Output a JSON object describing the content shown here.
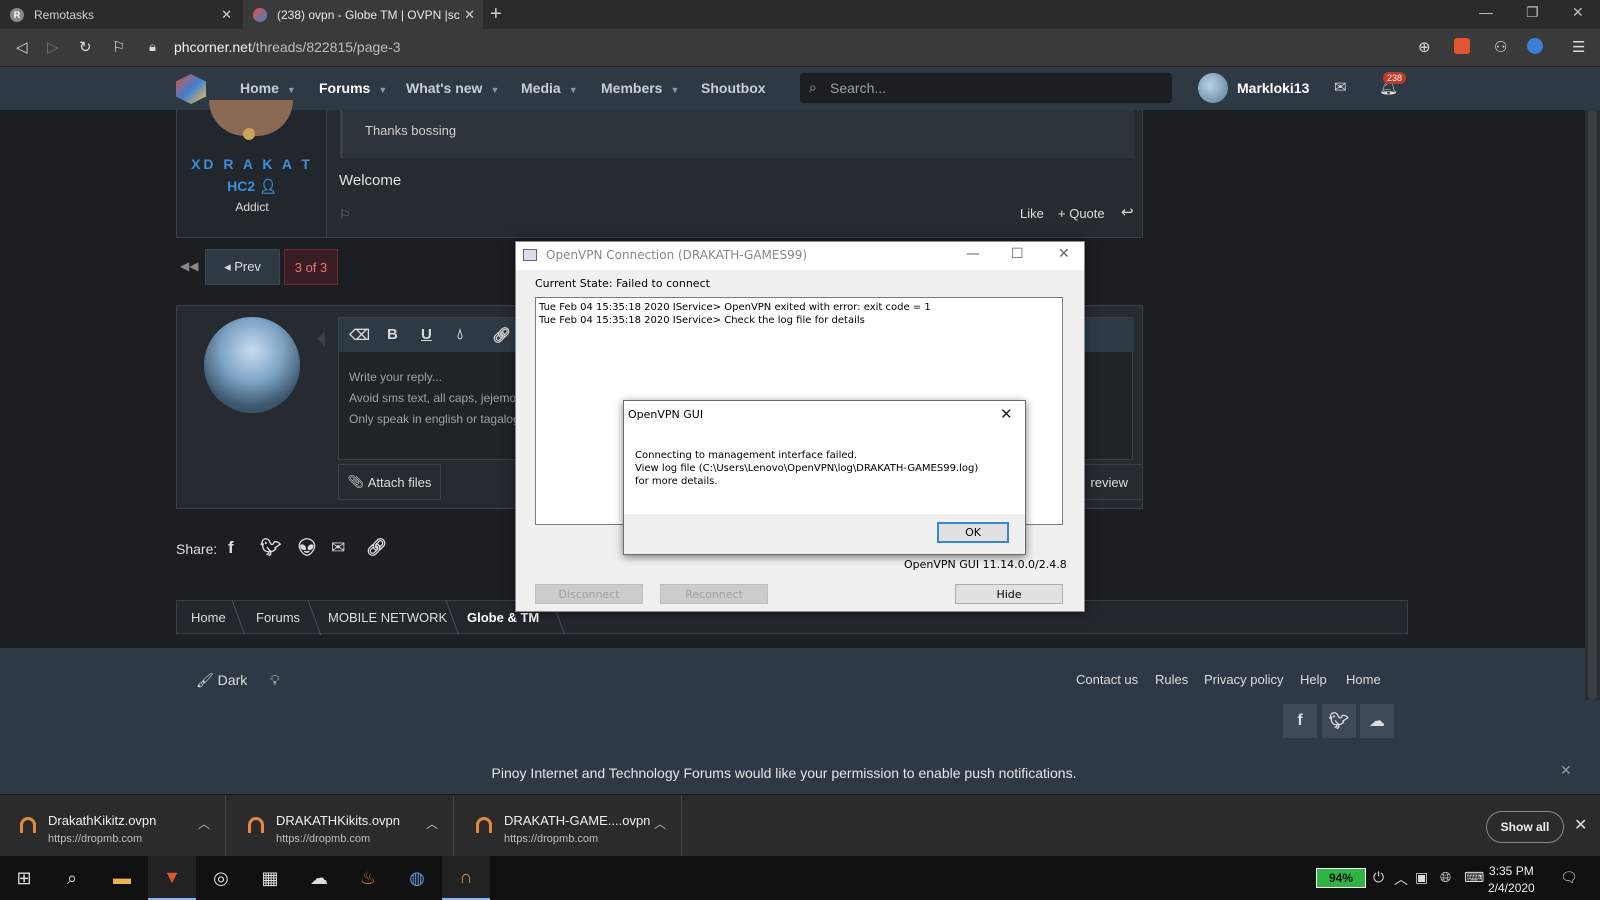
{
  "browser": {
    "tabs": [
      {
        "title": "Remotasks",
        "favicon": "R"
      },
      {
        "title": "(238) ovpn - Globe TM | OVPN |sc",
        "favicon": ""
      }
    ],
    "url_domain": "phcorner.net",
    "url_path": "/threads/822815/page-3"
  },
  "site": {
    "nav": [
      {
        "label": "Home"
      },
      {
        "label": "Forums"
      },
      {
        "label": "What's new"
      },
      {
        "label": "Media"
      },
      {
        "label": "Members"
      },
      {
        "label": "Shoutbox"
      }
    ],
    "search_placeholder": "Search...",
    "username": "Markloki13",
    "alerts_count": "238"
  },
  "post": {
    "author": "XD R A K A T",
    "rank": "HC2",
    "user_title": "Addict",
    "quote": "Thanks bossing",
    "message": "Welcome",
    "like_label": "Like",
    "quote_label": "+ Quote"
  },
  "pagination": {
    "prev_label": "◂ Prev",
    "current": "3 of 3"
  },
  "reply": {
    "placeholder_lines": [
      "Write your reply...",
      "Avoid sms text, all caps, jejemor",
      "Only speak in english or tagalog"
    ],
    "attach_label": "Attach files",
    "preview_label": "review"
  },
  "share_label": "Share:",
  "breadcrumb": [
    "Home",
    "Forums",
    "MOBILE NETWORK",
    "Globe & TM"
  ],
  "footer": {
    "theme_label": "Dark",
    "links": [
      "Contact us",
      "Rules",
      "Privacy policy",
      "Help",
      "Home"
    ],
    "push_message": "Pinoy Internet and Technology Forums would like your permission to enable push notifications."
  },
  "downloads": {
    "items": [
      {
        "name": "DrakathKikitz.ovpn",
        "source": "https://dropmb.com"
      },
      {
        "name": "DRAKATHKikits.ovpn",
        "source": "https://dropmb.com"
      },
      {
        "name": "DRAKATH-GAME....ovpn",
        "source": "https://dropmb.com"
      }
    ],
    "show_all_label": "Show all"
  },
  "taskbar": {
    "battery": "94%",
    "time": "3:35 PM",
    "date": "2/4/2020"
  },
  "vpn_window": {
    "title": "OpenVPN Connection (DRAKATH-GAMES99)",
    "state": "Current State: Failed to connect",
    "log_lines": [
      "Tue Feb 04 15:35:18 2020 IService> OpenVPN exited with error: exit code = 1",
      "Tue Feb 04 15:35:18 2020 IService> Check the log file for details"
    ],
    "version": "OpenVPN GUI 11.14.0.0/2.4.8",
    "disconnect_label": "Disconnect",
    "reconnect_label": "Reconnect",
    "hide_label": "Hide"
  },
  "error_dialog": {
    "title": "OpenVPN GUI",
    "message_lines": [
      "Connecting to management interface failed.",
      "View log file (C:\\Users\\Lenovo\\OpenVPN\\log\\DRAKATH-GAMES99.log)",
      "for more details."
    ],
    "ok_label": "OK"
  }
}
